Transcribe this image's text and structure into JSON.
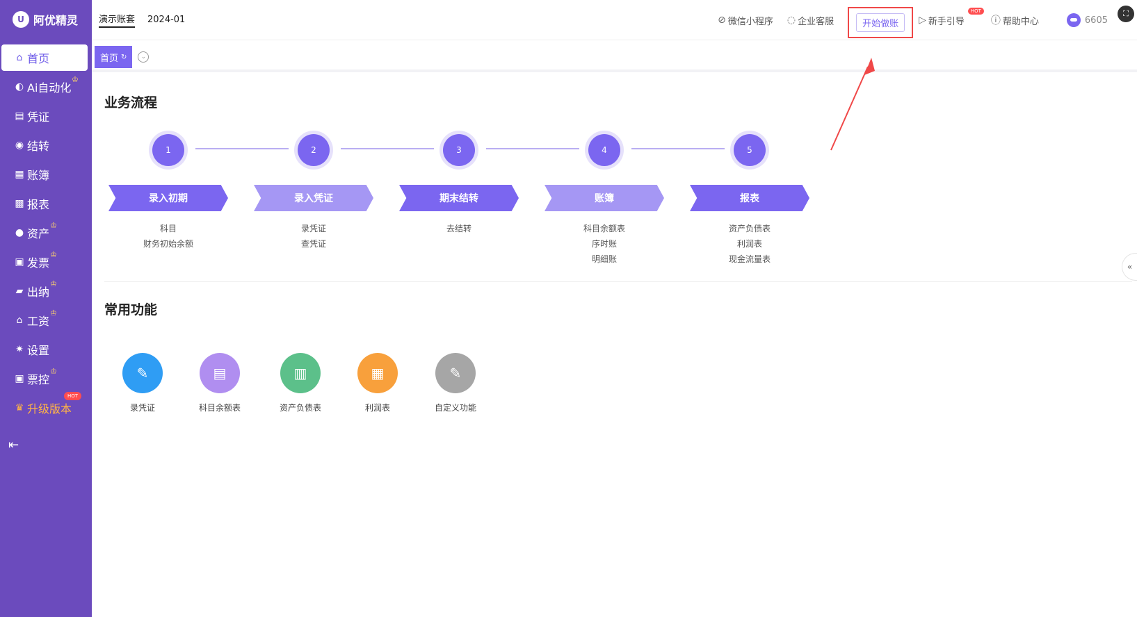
{
  "app": {
    "logo_text": "阿优精灵",
    "logo_mark": "U"
  },
  "sidebar": {
    "items": [
      {
        "label": "首页",
        "icon": "home-icon",
        "glyph": "⌂",
        "active": true,
        "vip": false
      },
      {
        "label": "Ai自动化",
        "icon": "robot-icon",
        "glyph": "◐",
        "active": false,
        "vip": true
      },
      {
        "label": "凭证",
        "icon": "voucher-icon",
        "glyph": "▤",
        "active": false,
        "vip": false
      },
      {
        "label": "结转",
        "icon": "carryover-icon",
        "glyph": "◉",
        "active": false,
        "vip": false
      },
      {
        "label": "账簿",
        "icon": "ledger-icon",
        "glyph": "▦",
        "active": false,
        "vip": false
      },
      {
        "label": "报表",
        "icon": "report-icon",
        "glyph": "▩",
        "active": false,
        "vip": false
      },
      {
        "label": "资产",
        "icon": "asset-icon",
        "glyph": "●",
        "active": false,
        "vip": true
      },
      {
        "label": "发票",
        "icon": "invoice-icon",
        "glyph": "▣",
        "active": false,
        "vip": true
      },
      {
        "label": "出纳",
        "icon": "wallet-icon",
        "glyph": "▰",
        "active": false,
        "vip": true
      },
      {
        "label": "工资",
        "icon": "salary-icon",
        "glyph": "⌂",
        "active": false,
        "vip": true
      },
      {
        "label": "设置",
        "icon": "gear-icon",
        "glyph": "✷",
        "active": false,
        "vip": false
      },
      {
        "label": "票控",
        "icon": "ticket-control-icon",
        "glyph": "▣",
        "active": false,
        "vip": true
      }
    ],
    "upgrade": {
      "label": "升级版本",
      "badge": "HOT"
    },
    "crown_glyph": "♔",
    "collapse_glyph": "⇤"
  },
  "header": {
    "account_name": "演示账套",
    "period": "2024-01",
    "links": {
      "wechat": "微信小程序",
      "service": "企业客服",
      "start": "开始做账",
      "guide": "新手引导",
      "guide_badge": "HOT",
      "help": "帮助中心"
    },
    "user_id": "6605"
  },
  "tabs": {
    "home": "首页",
    "refresh_glyph": "↻",
    "more_glyph": "⌄"
  },
  "workflow": {
    "title": "业务流程",
    "steps": [
      {
        "num": "1",
        "label": "录入初期",
        "links": [
          "科目",
          "财务初始余额"
        ]
      },
      {
        "num": "2",
        "label": "录入凭证",
        "links": [
          "录凭证",
          "查凭证"
        ]
      },
      {
        "num": "3",
        "label": "期末结转",
        "links": [
          "去结转"
        ]
      },
      {
        "num": "4",
        "label": "账簿",
        "links": [
          "科目余额表",
          "序时账",
          "明细账"
        ]
      },
      {
        "num": "5",
        "label": "报表",
        "links": [
          "资产负债表",
          "利润表",
          "现金流量表"
        ]
      }
    ]
  },
  "common": {
    "title": "常用功能",
    "items": [
      {
        "label": "录凭证",
        "icon": "voucher-entry-icon",
        "color": "#2f9df4",
        "glyph": "✎"
      },
      {
        "label": "科目余额表",
        "icon": "book-icon",
        "color": "#b08ef0",
        "glyph": "▤"
      },
      {
        "label": "资产负债表",
        "icon": "balance-sheet-icon",
        "color": "#5cc08a",
        "glyph": "▥"
      },
      {
        "label": "利润表",
        "icon": "profit-chart-icon",
        "color": "#f8a03c",
        "glyph": "▦"
      },
      {
        "label": "自定义功能",
        "icon": "custom-edit-icon",
        "color": "#a6a6a6",
        "glyph": "✎"
      }
    ]
  },
  "colors": {
    "sidebar": "#6b4bbd",
    "accent": "#7b66f0",
    "highlight": "#f04848"
  }
}
